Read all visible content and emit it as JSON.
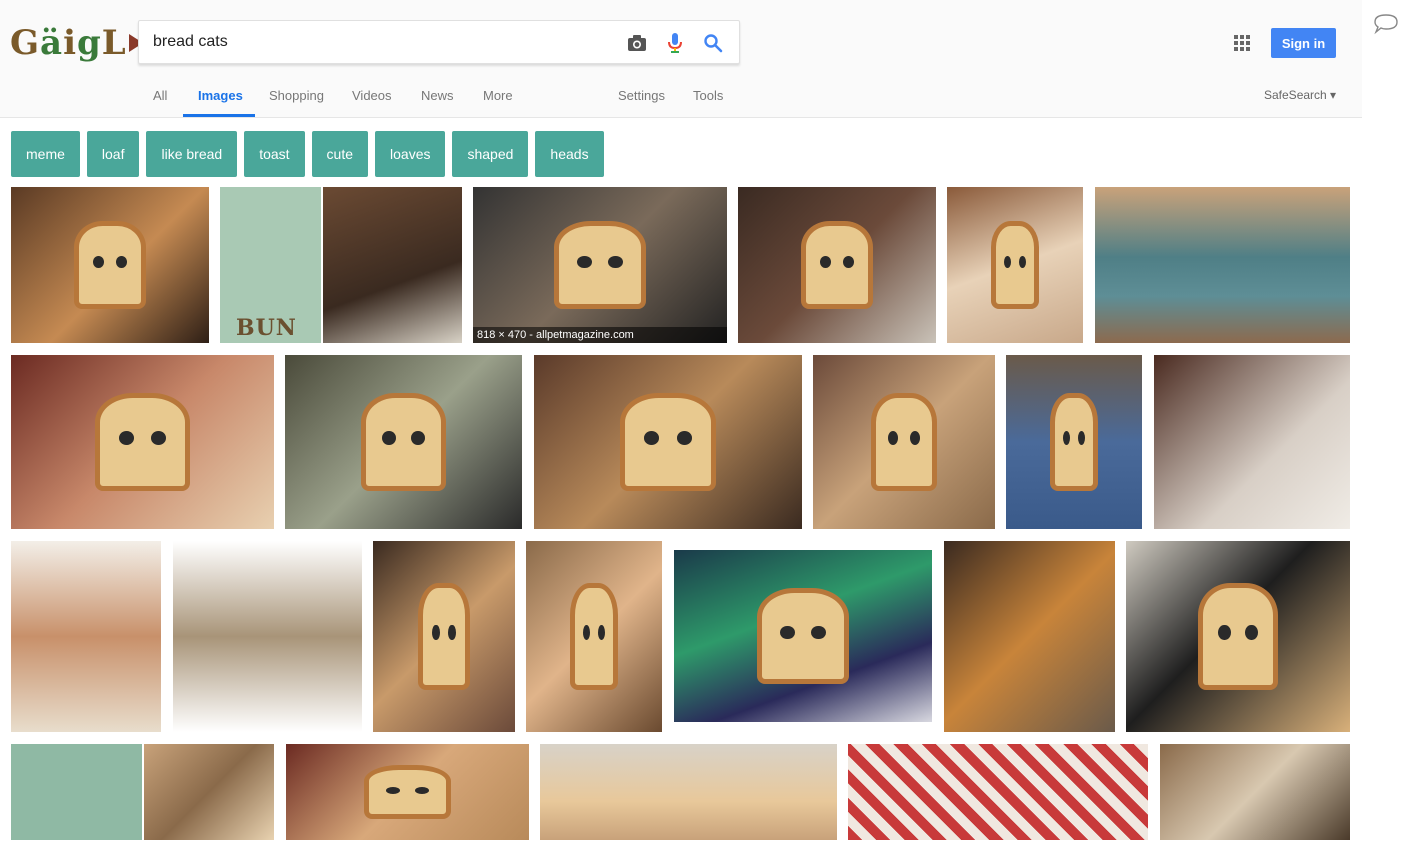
{
  "search": {
    "query": "bread cats"
  },
  "tabs": [
    {
      "label": "All"
    },
    {
      "label": "Images"
    },
    {
      "label": "Shopping"
    },
    {
      "label": "Videos"
    },
    {
      "label": "News"
    },
    {
      "label": "More"
    },
    {
      "label": "Settings"
    },
    {
      "label": "Tools"
    }
  ],
  "header": {
    "signin": "Sign in",
    "safesearch": "SafeSearch ▾"
  },
  "chips": [
    "meme",
    "loaf",
    "like bread",
    "toast",
    "cute",
    "loaves",
    "shaped",
    "heads"
  ],
  "results": {
    "hover_caption": "818 × 470 - allpetmagazine.com",
    "bun_label": "BUN"
  },
  "colors": {
    "accent": "#1a73e8",
    "signin": "#4285f4",
    "chip": "#4aa79a"
  },
  "icons": [
    "camera-icon",
    "microphone-icon",
    "search-icon",
    "apps-grid-icon",
    "feedback-icon"
  ]
}
